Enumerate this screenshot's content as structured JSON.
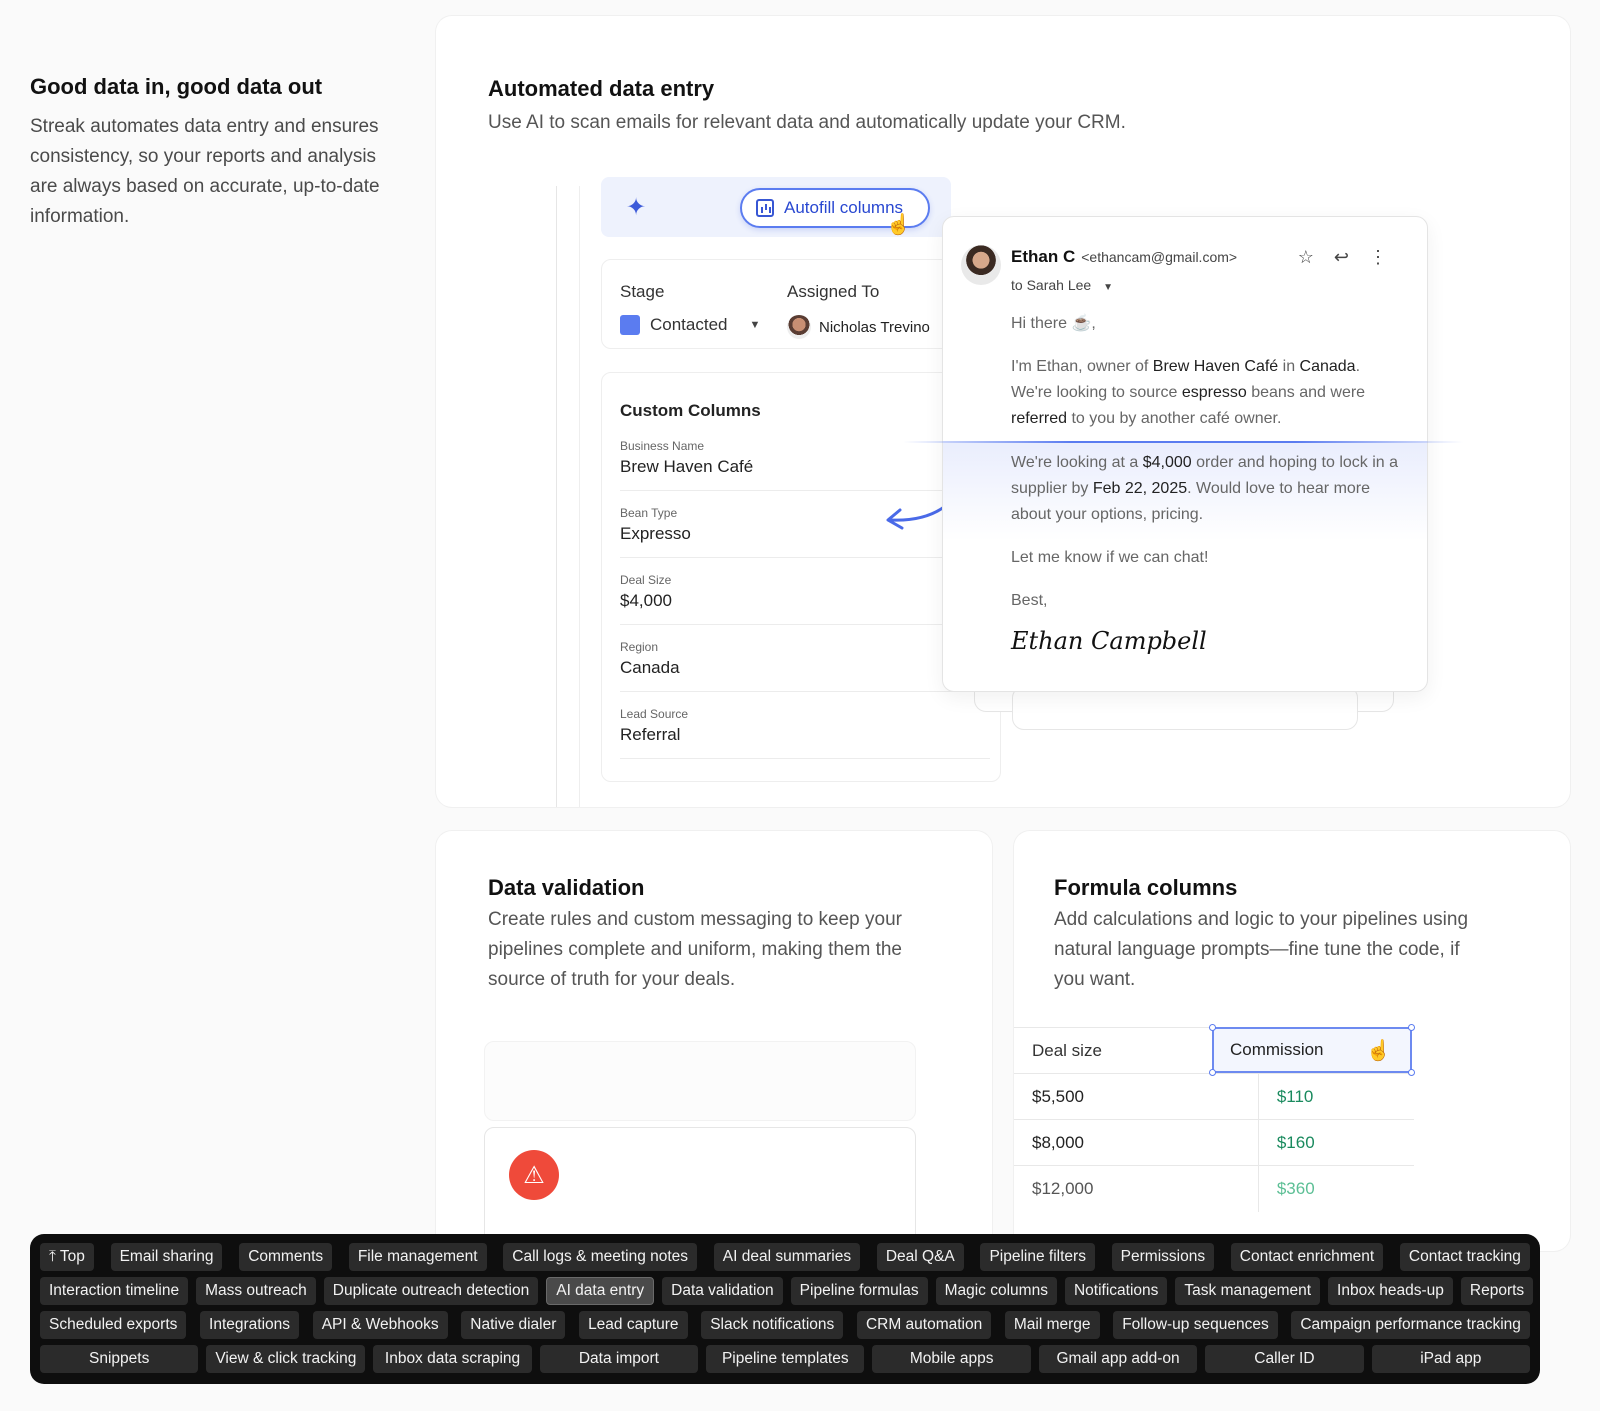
{
  "intro": {
    "title": "Good data in, good data out",
    "text": "Streak automates data entry and ensures consistency, so your reports and analysis are always based on accurate, up-to-date information."
  },
  "automated": {
    "title": "Automated data entry",
    "desc": "Use AI to scan emails for relevant data and automatically update your CRM.",
    "autofill_label": "Autofill columns",
    "stage_label": "Stage",
    "stage_value": "Contacted",
    "assigned_label": "Assigned To",
    "assigned_value": "Nicholas Trevino",
    "custom_title": "Custom Columns",
    "fields": [
      {
        "label": "Business Name",
        "value": "Brew Haven Café"
      },
      {
        "label": "Bean Type",
        "value": "Expresso"
      },
      {
        "label": "Deal Size",
        "value": "$4,000"
      },
      {
        "label": "Region",
        "value": "Canada"
      },
      {
        "label": "Lead Source",
        "value": "Referral"
      }
    ],
    "email": {
      "sender": "Ethan C",
      "address": "<ethancam@gmail.com>",
      "to": "to Sarah Lee",
      "greeting": "Hi there ☕,",
      "p1_a": "I'm Ethan, owner of ",
      "p1_b": "Brew Haven Café",
      "p1_c": " in ",
      "p1_d": "Canada",
      "p1_e": ". We're looking to source ",
      "p1_f": "espresso",
      "p1_g": " beans and were ",
      "p1_h": "referred",
      "p1_i": " to you by another café owner.",
      "p2_a": "We're looking at a ",
      "p2_b": "$4,000",
      "p2_c": " order and hoping to lock in a supplier by ",
      "p2_d": "Feb 22, 2025",
      "p2_e": ". Would love to hear more about your options, pricing.",
      "p3": "Let me know if we can chat!",
      "closing": "Best,",
      "signature": "Ethan Campbell"
    }
  },
  "validation": {
    "title": "Data validation",
    "desc": "Create rules and custom messaging to keep your pipelines complete and uniform, making them the source of truth for your deals."
  },
  "formula": {
    "title": "Formula columns",
    "desc": "Add calculations and logic to your pipelines using natural language prompts—fine tune the code, if you want.",
    "col1": "Deal size",
    "col2": "Commission",
    "rows": [
      {
        "deal": "$5,500",
        "commission": "$110"
      },
      {
        "deal": "$8,000",
        "commission": "$160"
      },
      {
        "deal": "$12,000",
        "commission": "$360"
      }
    ]
  },
  "nav": {
    "rows": [
      [
        "⤒ Top",
        "Email sharing",
        "Comments",
        "File management",
        "Call logs & meeting notes",
        "AI deal summaries",
        "Deal Q&A",
        "Pipeline filters",
        "Permissions",
        "Contact enrichment",
        "Contact tracking"
      ],
      [
        "Interaction timeline",
        "Mass outreach",
        "Duplicate outreach detection",
        "AI data entry",
        "Data validation",
        "Pipeline formulas",
        "Magic columns",
        "Notifications",
        "Task management",
        "Inbox heads-up",
        "Reports"
      ],
      [
        "Scheduled exports",
        "Integrations",
        "API & Webhooks",
        "Native dialer",
        "Lead capture",
        "Slack notifications",
        "CRM automation",
        "Mail merge",
        "Follow-up sequences",
        "Campaign performance tracking"
      ],
      [
        "Snippets",
        "View & click tracking",
        "Inbox data scraping",
        "Data import",
        "Pipeline templates",
        "Mobile apps",
        "Gmail app add-on",
        "Caller ID",
        "iPad app"
      ]
    ],
    "active": "AI data entry"
  }
}
